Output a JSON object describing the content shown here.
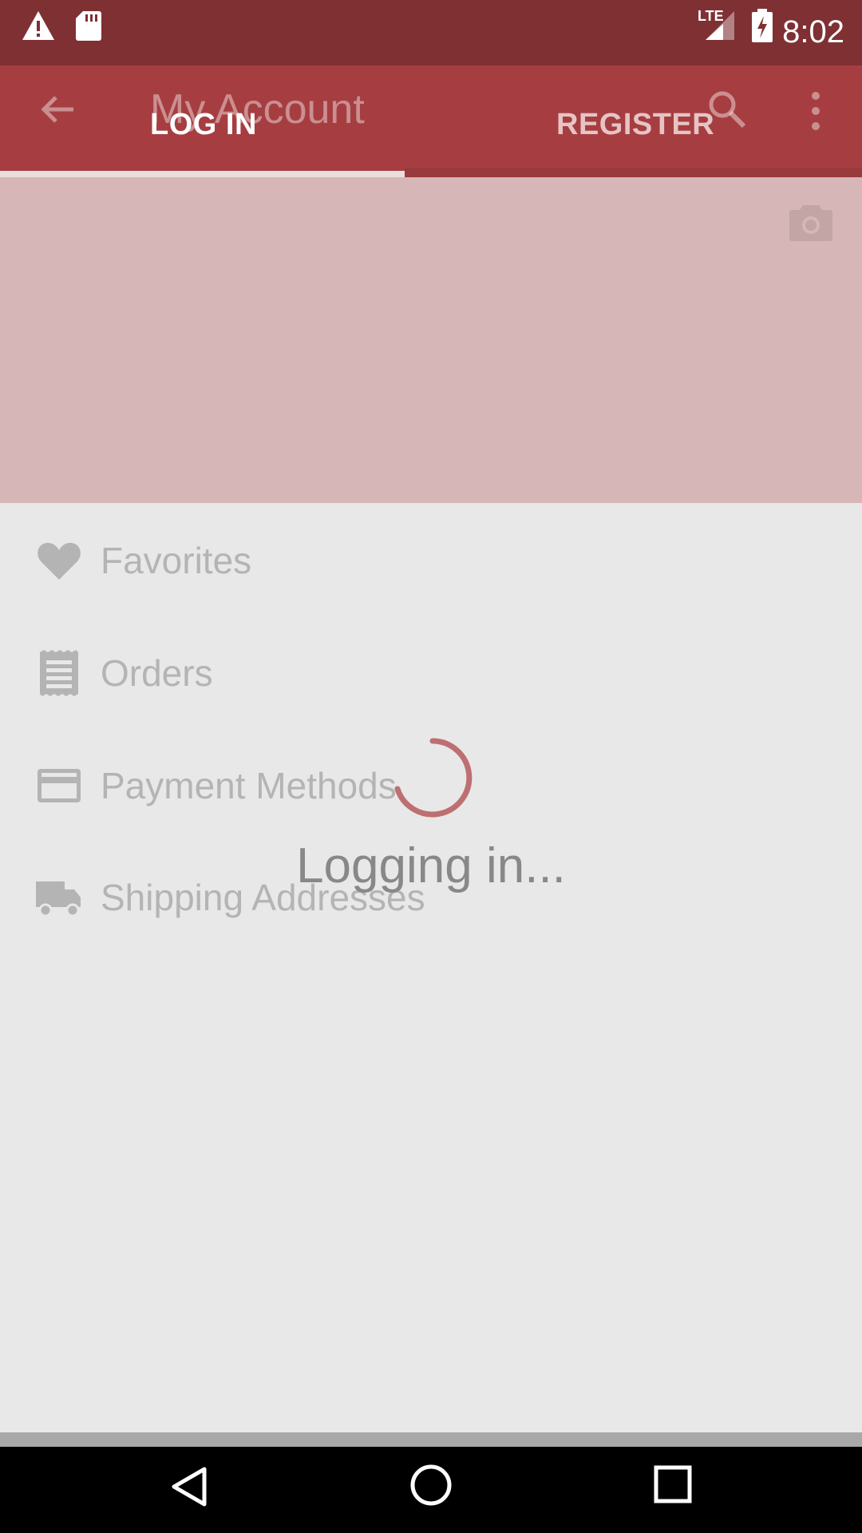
{
  "status_bar": {
    "time": "8:02",
    "network": "LTE",
    "icons": [
      "warning-icon",
      "sd-card-icon",
      "lte-signal-icon",
      "battery-charging-icon"
    ]
  },
  "app_bar": {
    "title": "My Account",
    "icons": [
      "back-arrow-icon",
      "search-icon",
      "overflow-menu-icon"
    ]
  },
  "tabs": {
    "login_label": "LOG IN",
    "register_label": "REGISTER",
    "selected": "LOG IN"
  },
  "header": {
    "icon": "camera-icon"
  },
  "menu": {
    "items": [
      {
        "label": "Favorites",
        "icon": "heart-icon"
      },
      {
        "label": "Orders",
        "icon": "receipt-icon"
      },
      {
        "label": "Payment Methods",
        "icon": "credit-card-icon"
      },
      {
        "label": "Shipping Addresses",
        "icon": "truck-icon"
      }
    ]
  },
  "loading": {
    "text": "Logging in..."
  },
  "nav_bar": {
    "icons": [
      "back-icon",
      "home-icon",
      "recents-icon"
    ]
  },
  "colors": {
    "status_bar": "#7f3033",
    "app_bar": "#a63e41",
    "header": "#d6b6b6",
    "background": "#e8e8e8",
    "spinner": "#b5595c"
  }
}
